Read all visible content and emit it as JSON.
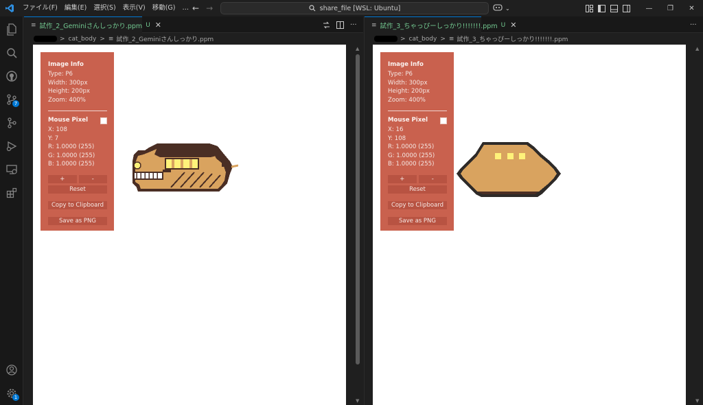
{
  "titlebar": {
    "menus": [
      "ファイル(F)",
      "編集(E)",
      "選択(S)",
      "表示(V)",
      "移動(G)",
      "…"
    ],
    "command_center": "share_file [WSL: Ubuntu]"
  },
  "activitybar": {
    "source_control_badge": "7",
    "settings_badge": "1"
  },
  "editors": {
    "left": {
      "tab_label": "試作_2_Geminiさんしっかり.ppm",
      "tab_flag": "U",
      "breadcrumb_folder": "cat_body",
      "breadcrumb_file": "試作_2_Geminiさんしっかり.ppm",
      "info": {
        "title": "Image Info",
        "type": "Type: P6",
        "width": "Width: 300px",
        "height": "Height: 200px",
        "zoom": "Zoom: 400%",
        "mouse_title": "Mouse Pixel",
        "x": "X: 108",
        "y": "Y: 7",
        "r": "R: 1.0000 (255)",
        "g": "G: 1.0000 (255)",
        "b": "B: 1.0000 (255)",
        "zoom_in": "+",
        "zoom_out": "-",
        "reset": "Reset",
        "copy": "Copy to Clipboard",
        "save": "Save as PNG"
      }
    },
    "right": {
      "tab_label": "試作_3_ちゃっぴーしっかり!!!!!!!.ppm",
      "tab_flag": "U",
      "breadcrumb_folder": "cat_body",
      "breadcrumb_file": "試作_3_ちゃっぴーしっかり!!!!!!!.ppm",
      "info": {
        "title": "Image Info",
        "type": "Type: P6",
        "width": "Width: 300px",
        "height": "Height: 200px",
        "zoom": "Zoom: 400%",
        "mouse_title": "Mouse Pixel",
        "x": "X: 16",
        "y": "Y: 108",
        "r": "R: 1.0000 (255)",
        "g": "G: 1.0000 (255)",
        "b": "B: 1.0000 (255)",
        "zoom_in": "+",
        "zoom_out": "-",
        "reset": "Reset",
        "copy": "Copy to Clipboard",
        "save": "Save as PNG"
      }
    }
  },
  "colors": {
    "panel": "#c9614e",
    "sprite_body": "#d9a35f",
    "sprite_dark": "#4a2e24",
    "sprite_window": "#fff27a"
  }
}
